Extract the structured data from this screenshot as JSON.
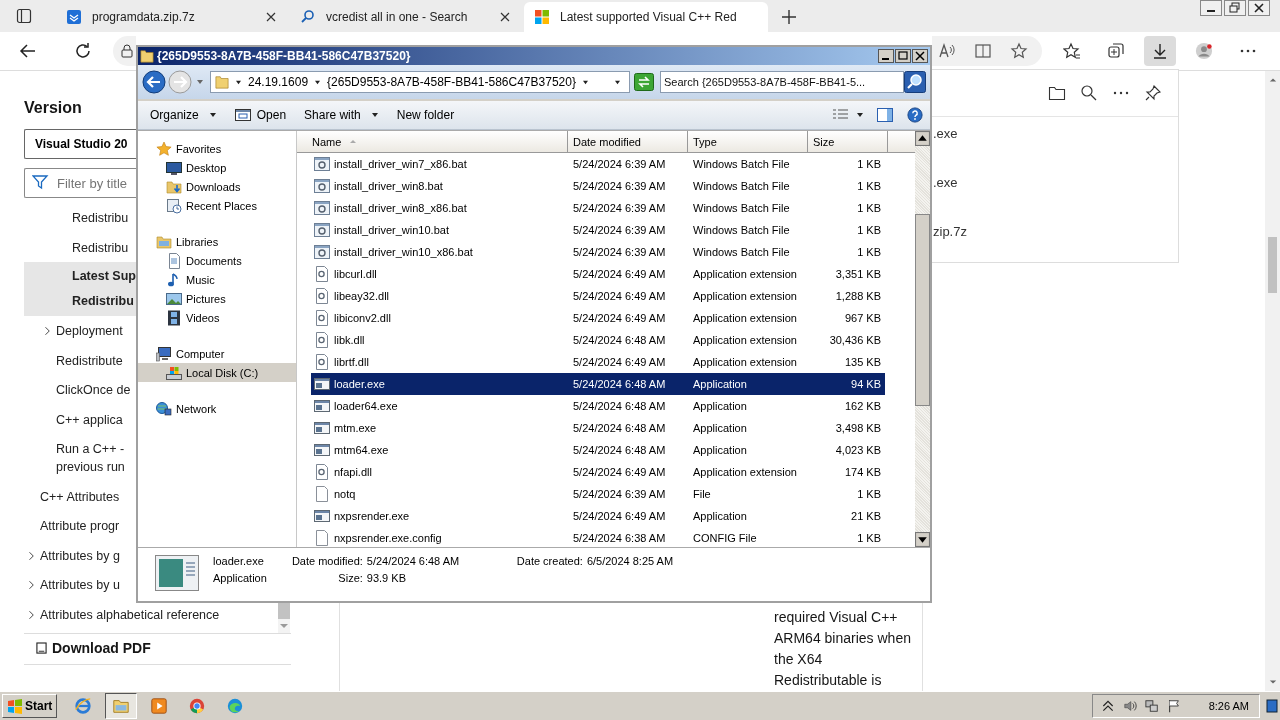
{
  "browser": {
    "tabs": [
      {
        "title": "programdata.zip.7z",
        "kind": "archive",
        "selected": false
      },
      {
        "title": "vcredist all in one - Search",
        "kind": "search",
        "selected": false
      },
      {
        "title": "Latest supported Visual C++ Red",
        "kind": "site",
        "selected": true
      }
    ],
    "downloads_open": true,
    "downloads_panel": {
      "items": [
        ".exe",
        ".exe",
        "zip.7z"
      ]
    }
  },
  "sidebar": {
    "heading": "Version",
    "version": "Visual Studio 20",
    "filter_placeholder": "Filter by title",
    "toc": [
      {
        "children": [
          {
            "children": [
              {
                "lines": [
                  "Redistribu"
                ],
                "expandable": false,
                "selected": false
              },
              {
                "lines": [
                  "Redistribu"
                ],
                "expandable": false,
                "selected": false
              },
              {
                "lines": [
                  "Latest Sup",
                  "Redistribu"
                ],
                "expandable": false,
                "selected": true
              }
            ]
          },
          {
            "lines": [
              "Deployment"
            ],
            "expandable": true,
            "selected": false
          },
          {
            "lines": [
              "Redistribute"
            ],
            "expandable": false,
            "selected": false
          },
          {
            "lines": [
              "ClickOnce de"
            ],
            "expandable": false,
            "selected": false
          },
          {
            "lines": [
              "C++ applica"
            ],
            "expandable": false,
            "selected": false
          },
          {
            "lines": [
              "Run a C++ -",
              "previous run"
            ],
            "expandable": false,
            "selected": false
          }
        ]
      },
      {
        "lines": [
          "C++ Attributes"
        ],
        "expandable": false,
        "selected": false
      },
      {
        "lines": [
          "Attribute progr"
        ],
        "expandable": false,
        "selected": false
      },
      {
        "lines": [
          "Attributes by g"
        ],
        "expandable": true,
        "selected": false
      },
      {
        "lines": [
          "Attributes by u"
        ],
        "expandable": true,
        "selected": false
      },
      {
        "lines": [
          "Attributes alphabetical reference"
        ],
        "expandable": true,
        "selected": false
      }
    ],
    "download": "Download PDF"
  },
  "article": {
    "lines": [
      "required Visual C++",
      "ARM64 binaries when",
      "the X64",
      "Redistributable is"
    ]
  },
  "explorer": {
    "title": "{265D9553-8A7B-458F-BB41-586C47B37520}",
    "crumbs": [
      "24.19.1609",
      "{265D9553-8A7B-458F-BB41-586C47B37520}"
    ],
    "search_placeholder": "Search {265D9553-8A7B-458F-BB41-5...",
    "commands": [
      {
        "label": "Organize",
        "dropdown": true,
        "kind": "menu"
      },
      {
        "label": "Open",
        "dropdown": false,
        "kind": "open"
      },
      {
        "label": "Share with",
        "dropdown": true,
        "kind": "menu"
      },
      {
        "label": "New folder",
        "dropdown": false,
        "kind": "menu"
      }
    ],
    "nav": [
      {
        "label": "Favorites",
        "kind": "favorites",
        "children": [
          {
            "label": "Desktop",
            "kind": "desktop",
            "selected": false
          },
          {
            "label": "Downloads",
            "kind": "downloads",
            "selected": false
          },
          {
            "label": "Recent Places",
            "kind": "recent",
            "selected": false
          }
        ]
      },
      {
        "label": "Libraries",
        "kind": "libraries",
        "children": [
          {
            "label": "Documents",
            "kind": "documents",
            "selected": false
          },
          {
            "label": "Music",
            "kind": "music",
            "selected": false
          },
          {
            "label": "Pictures",
            "kind": "pictures",
            "selected": false
          },
          {
            "label": "Videos",
            "kind": "videos",
            "selected": false
          }
        ]
      },
      {
        "label": "Computer",
        "kind": "computer",
        "children": [
          {
            "label": "Local Disk (C:)",
            "kind": "disk",
            "selected": true
          }
        ]
      },
      {
        "label": "Network",
        "kind": "network"
      }
    ],
    "columns": [
      "Name",
      "Date modified",
      "Type",
      "Size"
    ],
    "rows": [
      {
        "name": "install_driver_win7_x86.bat",
        "date": "5/24/2024 6:39 AM",
        "type": "Windows Batch File",
        "size": "1 KB",
        "kind": "batch",
        "selected": false
      },
      {
        "name": "install_driver_win8.bat",
        "date": "5/24/2024 6:39 AM",
        "type": "Windows Batch File",
        "size": "1 KB",
        "kind": "batch",
        "selected": false
      },
      {
        "name": "install_driver_win8_x86.bat",
        "date": "5/24/2024 6:39 AM",
        "type": "Windows Batch File",
        "size": "1 KB",
        "kind": "batch",
        "selected": false
      },
      {
        "name": "install_driver_win10.bat",
        "date": "5/24/2024 6:39 AM",
        "type": "Windows Batch File",
        "size": "1 KB",
        "kind": "batch",
        "selected": false
      },
      {
        "name": "install_driver_win10_x86.bat",
        "date": "5/24/2024 6:39 AM",
        "type": "Windows Batch File",
        "size": "1 KB",
        "kind": "batch",
        "selected": false
      },
      {
        "name": "libcurl.dll",
        "date": "5/24/2024 6:49 AM",
        "type": "Application extension",
        "size": "3,351 KB",
        "kind": "dll",
        "selected": false
      },
      {
        "name": "libeay32.dll",
        "date": "5/24/2024 6:49 AM",
        "type": "Application extension",
        "size": "1,288 KB",
        "kind": "dll",
        "selected": false
      },
      {
        "name": "libiconv2.dll",
        "date": "5/24/2024 6:49 AM",
        "type": "Application extension",
        "size": "967 KB",
        "kind": "dll",
        "selected": false
      },
      {
        "name": "libk.dll",
        "date": "5/24/2024 6:48 AM",
        "type": "Application extension",
        "size": "30,436 KB",
        "kind": "dll",
        "selected": false
      },
      {
        "name": "librtf.dll",
        "date": "5/24/2024 6:49 AM",
        "type": "Application extension",
        "size": "135 KB",
        "kind": "dll",
        "selected": false
      },
      {
        "name": "loader.exe",
        "date": "5/24/2024 6:48 AM",
        "type": "Application",
        "size": "94 KB",
        "kind": "exe",
        "selected": true
      },
      {
        "name": "loader64.exe",
        "date": "5/24/2024 6:48 AM",
        "type": "Application",
        "size": "162 KB",
        "kind": "exe",
        "selected": false
      },
      {
        "name": "mtm.exe",
        "date": "5/24/2024 6:48 AM",
        "type": "Application",
        "size": "3,498 KB",
        "kind": "exe",
        "selected": false
      },
      {
        "name": "mtm64.exe",
        "date": "5/24/2024 6:48 AM",
        "type": "Application",
        "size": "4,023 KB",
        "kind": "exe",
        "selected": false
      },
      {
        "name": "nfapi.dll",
        "date": "5/24/2024 6:49 AM",
        "type": "Application extension",
        "size": "174 KB",
        "kind": "dll",
        "selected": false
      },
      {
        "name": "notq",
        "date": "5/24/2024 6:39 AM",
        "type": "File",
        "size": "1 KB",
        "kind": "file",
        "selected": false
      },
      {
        "name": "nxpsrender.exe",
        "date": "5/24/2024 6:49 AM",
        "type": "Application",
        "size": "21 KB",
        "kind": "exe",
        "selected": false
      },
      {
        "name": "nxpsrender.exe.config",
        "date": "5/24/2024 6:38 AM",
        "type": "CONFIG File",
        "size": "1 KB",
        "kind": "file",
        "selected": false
      }
    ],
    "details": {
      "name": "loader.exe",
      "type": "Application",
      "fields": [
        {
          "label": "Date modified:",
          "value": "5/24/2024 6:48 AM"
        },
        {
          "label": "Size:",
          "value": "93.9 KB"
        },
        {
          "label": "Date created:",
          "value": "6/5/2024 8:25 AM"
        }
      ]
    }
  },
  "taskbar": {
    "start": "Start",
    "apps": [
      {
        "kind": "ie",
        "active": false
      },
      {
        "kind": "explorer",
        "active": true
      },
      {
        "kind": "media",
        "active": false
      },
      {
        "kind": "chrome",
        "active": false
      },
      {
        "kind": "edge",
        "active": false
      }
    ],
    "clock": "8:26 AM"
  }
}
